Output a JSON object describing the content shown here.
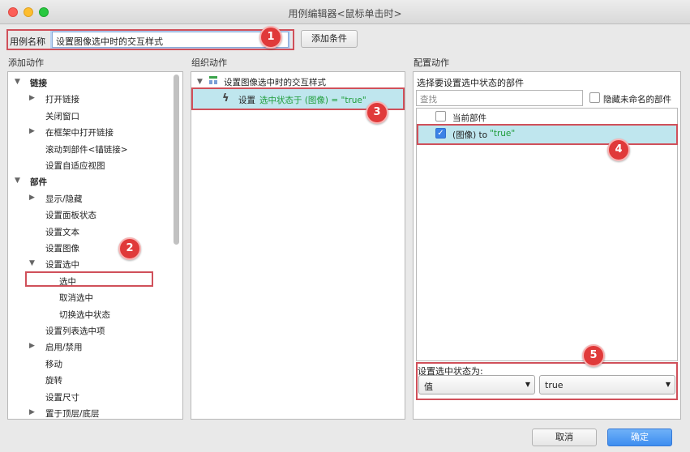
{
  "window": {
    "title": "用例编辑器<鼠标单击时>"
  },
  "case_name": {
    "label": "用例名称",
    "value": "设置图像选中时的交互样式"
  },
  "toolbar": {
    "add_condition": "添加条件"
  },
  "sections": {
    "add_action": "添加动作",
    "organize_action": "组织动作",
    "config_action": "配置动作"
  },
  "left_tree": {
    "items": [
      {
        "label": "链接",
        "arrow": "▼"
      },
      {
        "label": "打开链接",
        "arrow": "▶"
      },
      {
        "label": "关闭窗口",
        "arrow": ""
      },
      {
        "label": "在框架中打开链接",
        "arrow": "▶"
      },
      {
        "label": "滚动到部件<锚链接>",
        "arrow": ""
      },
      {
        "label": "设置自适应视图",
        "arrow": ""
      },
      {
        "label": "部件",
        "arrow": "▼"
      },
      {
        "label": "显示/隐藏",
        "arrow": "▶"
      },
      {
        "label": "设置面板状态",
        "arrow": ""
      },
      {
        "label": "设置文本",
        "arrow": ""
      },
      {
        "label": "设置图像",
        "arrow": ""
      },
      {
        "label": "设置选中",
        "arrow": "▼"
      },
      {
        "label": "选中",
        "arrow": ""
      },
      {
        "label": "取消选中",
        "arrow": ""
      },
      {
        "label": "切换选中状态",
        "arrow": ""
      },
      {
        "label": "设置列表选中项",
        "arrow": ""
      },
      {
        "label": "启用/禁用",
        "arrow": "▶"
      },
      {
        "label": "移动",
        "arrow": ""
      },
      {
        "label": "旋转",
        "arrow": ""
      },
      {
        "label": "设置尺寸",
        "arrow": ""
      },
      {
        "label": "置于顶层/底层",
        "arrow": "▶"
      }
    ]
  },
  "middle": {
    "case_title": "设置图像选中时的交互样式",
    "action_prefix": "设置",
    "action_text": "选中状态于 (图像) = \"true\""
  },
  "right": {
    "header": "选择要设置选中状态的部件",
    "search_placeholder": "查找",
    "hide_unnamed": "隐藏未命名的部件",
    "current_widget": "当前部件",
    "widget_item_label": "(图像) to ",
    "widget_item_value": "\"true\"",
    "set_state_label": "设置选中状态为:",
    "select_type": "值",
    "select_value": "true"
  },
  "footer": {
    "cancel": "取消",
    "ok": "确定"
  },
  "badges": [
    "1",
    "2",
    "3",
    "4",
    "5"
  ],
  "colors": {
    "highlight": "#d0505a",
    "badge": "#e03a3a",
    "selection": "#bfe6ee",
    "ok_button": "#3d8df0",
    "value_green": "#1f9d3a"
  }
}
